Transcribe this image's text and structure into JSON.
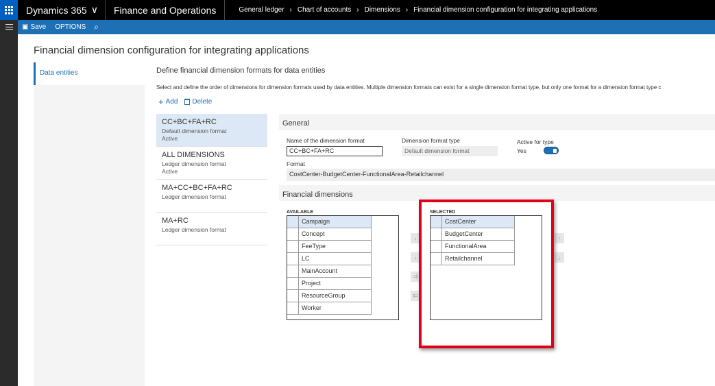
{
  "nav": {
    "brand": "Dynamics 365",
    "module": "Finance and Operations",
    "breadcrumbs": [
      "General ledger",
      "Chart of accounts",
      "Dimensions",
      "Financial dimension configuration for integrating applications"
    ]
  },
  "actions": {
    "save": "Save",
    "options": "OPTIONS"
  },
  "page": {
    "title": "Financial dimension configuration for integrating applications"
  },
  "sidenav": {
    "items": [
      {
        "label": "Data entities"
      }
    ]
  },
  "section": {
    "title": "Define financial dimension formats for data entities",
    "description": "Select and define the order of dimensions for dimension formats used by data entities. Multiple dimension formats can exist for a single dimension format type, but only one format for a dimension format type c"
  },
  "toolbar": {
    "add": "Add",
    "delete": "Delete"
  },
  "formats": [
    {
      "name": "CC+BC+FA+RC",
      "type": "Default dimension format",
      "status": "Active"
    },
    {
      "name": "ALL DIMENSIONS",
      "type": "Ledger dimension format",
      "status": "Active"
    },
    {
      "name": "MA+CC+BC+FA+RC",
      "type": "Ledger dimension format",
      "status": ""
    },
    {
      "name": "MA+RC",
      "type": "Ledger dimension format",
      "status": ""
    }
  ],
  "general": {
    "heading": "General",
    "name_label": "Name of the dimension format",
    "name_value": "CC+BC+FA+RC",
    "type_label": "Dimension format type",
    "type_value": "Default dimension format",
    "active_label": "Active for type",
    "active_value": "Yes",
    "format_label": "Format",
    "format_value": "CostCenter-BudgetCenter-FunctionalArea-Retailchannel"
  },
  "financial_dimensions": {
    "heading": "Financial dimensions",
    "available_label": "AVAILABLE",
    "available": [
      "Campaign",
      "Concept",
      "FeeType",
      "LC",
      "MainAccount",
      "Project",
      "ResourceGroup",
      "Worker"
    ],
    "selected_label": "SELECTED",
    "selected": [
      "CostCenter",
      "BudgetCenter",
      "FunctionalArea",
      "Retailchannel"
    ]
  },
  "colors": {
    "accent": "#1f6fb5",
    "highlight": "#e0001b"
  }
}
